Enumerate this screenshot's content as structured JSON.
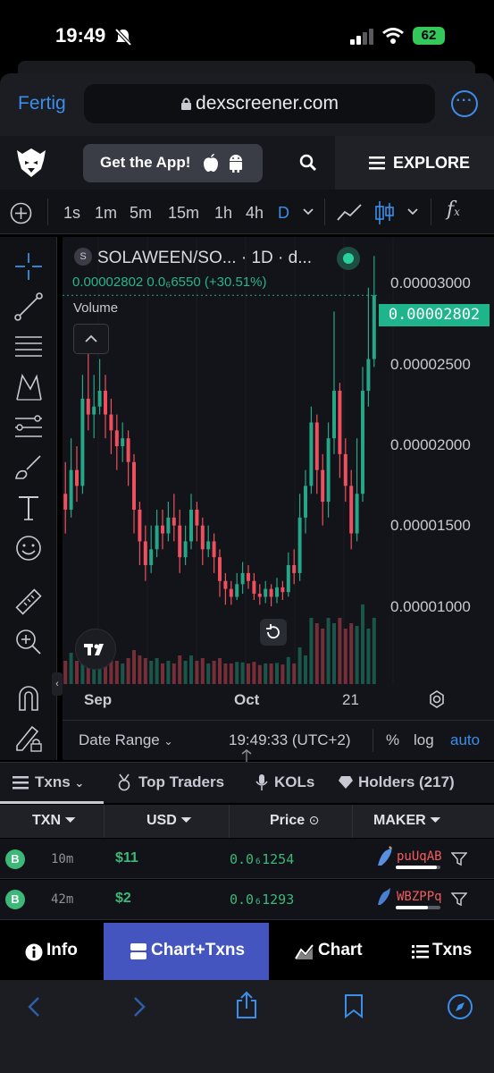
{
  "status": {
    "time": "19:49",
    "battery": "62"
  },
  "browser": {
    "done_label": "Fertig",
    "url": "dexscreener.com"
  },
  "header": {
    "app_banner": "Get the App!",
    "explore": "EXPLORE"
  },
  "toolbar": {
    "timeframes": [
      "1s",
      "1m",
      "5m",
      "15m",
      "1h",
      "4h",
      "D"
    ],
    "active_timeframe": "D",
    "fx_label": "f"
  },
  "chart": {
    "pair": "SOLAWEEN/SO...",
    "interval": "· 1D · d...",
    "price_line": "0.00002802  0.0₆6550 (+30.51%)",
    "volume_label": "Volume",
    "current_price": "0.00002802",
    "y_ticks": [
      "0.00003000",
      "0.00002500",
      "0.00002000",
      "0.00001500",
      "0.00001000"
    ],
    "x_labels": [
      "Sep",
      "Oct",
      "21"
    ],
    "date_range": "Date Range",
    "clock": "19:49:33 (UTC+2)",
    "pct": "%",
    "log": "log",
    "auto": "auto",
    "colors": {
      "up": "#26a688",
      "down": "#ef4f5f",
      "accent": "#3b8eea"
    }
  },
  "chart_data": {
    "type": "candlestick",
    "title": "",
    "x_labels_shown": [
      "Sep",
      "Oct",
      "21"
    ],
    "y_ticks": [
      3e-05,
      2.5e-05,
      2e-05,
      1.5e-05,
      1e-05
    ],
    "ylim": [
      3.5e-06,
      3.17e-05
    ],
    "last_price": 2.802e-05,
    "change_pct": 30.51
  },
  "tabs": [
    {
      "label": "Txns"
    },
    {
      "label": "Top Traders"
    },
    {
      "label": "KOLs"
    },
    {
      "label": "Holders (217)"
    }
  ],
  "table": {
    "headers": [
      "TXN",
      "USD",
      "Price",
      "MAKER"
    ],
    "rows": [
      {
        "type": "B",
        "age": "10m",
        "usd": "$11",
        "price": "0.0₆1254",
        "maker": "puUqAB"
      },
      {
        "type": "B",
        "age": "42m",
        "usd": "$2",
        "price": "0.0₆1293",
        "maker": "WBZPPq"
      }
    ]
  },
  "nav": [
    {
      "label": "Info"
    },
    {
      "label": "Chart+Txns"
    },
    {
      "label": "Chart"
    },
    {
      "label": "Txns"
    }
  ]
}
